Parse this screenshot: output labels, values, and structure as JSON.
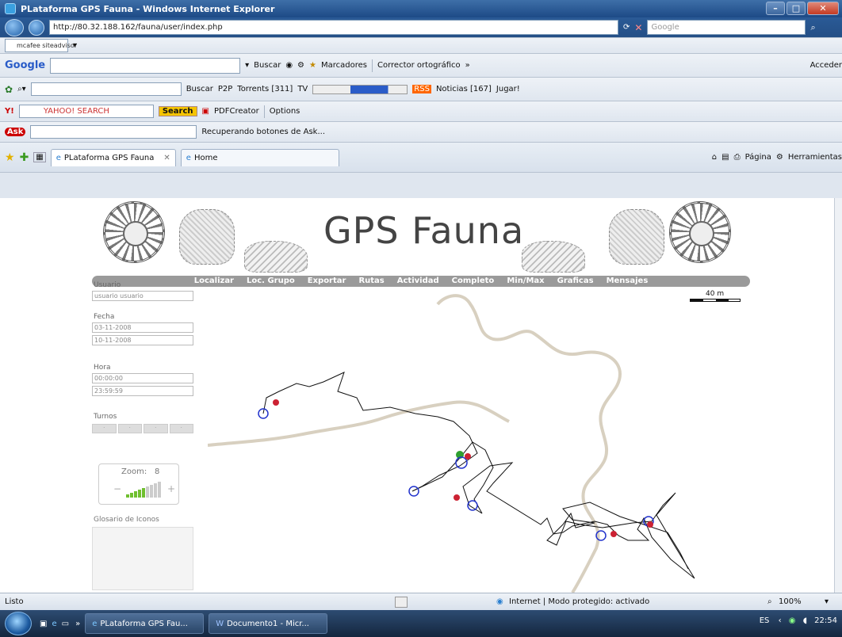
{
  "window": {
    "title": "PLataforma GPS Fauna - Windows Internet Explorer"
  },
  "address": {
    "url": "http://80.32.188.162/fauna/user/index.php",
    "search_placeholder": "Google"
  },
  "toolbar_mcafee": {
    "label": "mcafee siteadvisor"
  },
  "toolbar_google": {
    "brand": "Google",
    "buscar": "Buscar",
    "marcadores": "Marcadores",
    "corrector": "Corrector ortográfico",
    "acceder": "Acceder"
  },
  "toolbar_torrents": {
    "buscar": "Buscar",
    "p2p": "P2P",
    "torrents": "Torrents [311]",
    "tv": "TV",
    "noticias": "Noticias [167]",
    "jugar": "Jugar!"
  },
  "toolbar_yahoo": {
    "brand": "YAHOO! SEARCH",
    "search_btn": "Search",
    "pdfcreator": "PDFCreator",
    "options": "Options"
  },
  "toolbar_ask": {
    "brand": "Ask",
    "status": "Recuperando botones de Ask..."
  },
  "tabs": {
    "items": [
      {
        "label": "PLataforma GPS Fauna"
      },
      {
        "label": "Home"
      }
    ],
    "page_menu": "Página",
    "tools_menu": "Herramientas"
  },
  "page": {
    "title": "GPS Fauna",
    "menu": [
      "Localizar",
      "Loc. Grupo",
      "Exportar",
      "Rutas",
      "Actividad",
      "Completo",
      "Min/Max",
      "Graficas",
      "Mensajes"
    ],
    "usuario_label": "Usuario",
    "usuario_value": "usuario usuario",
    "fecha_label": "Fecha",
    "fecha_desde": "03-11-2008",
    "fecha_hasta": "10-11-2008",
    "hora_label": "Hora",
    "hora_desde": "00:00:00",
    "hora_hasta": "23:59:59",
    "turnos_label": "Turnos",
    "zoom_label": "Zoom:",
    "zoom_value": "8",
    "zoom_level_fraction": 0.55,
    "glosario_label": "Glosario de Iconos",
    "scale_label": "40 m"
  },
  "status": {
    "left": "Listo",
    "zone": "Internet | Modo protegido: activado",
    "zoom": "100%"
  },
  "taskbar": {
    "items": [
      {
        "label": "PLataforma GPS Fau..."
      },
      {
        "label": "Documento1 - Micr..."
      }
    ],
    "lang": "ES",
    "clock": "22:54"
  }
}
